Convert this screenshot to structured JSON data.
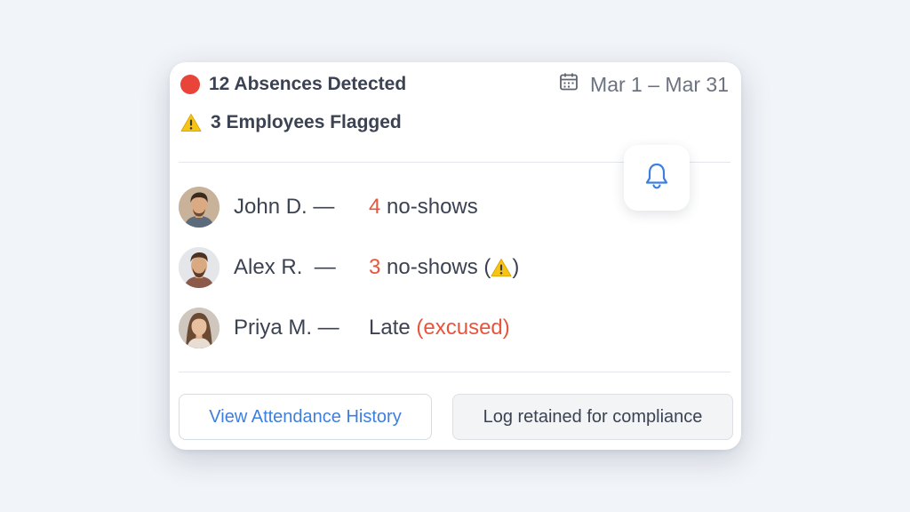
{
  "summary": {
    "absences": "12 Absences Detected",
    "date_range": "Mar 1 – Mar 31",
    "flagged": "3 Employees Flagged"
  },
  "employees": [
    {
      "name": "John D. —",
      "count": "4",
      "status": " no-shows",
      "suffix_pre": "",
      "suffix_post": ""
    },
    {
      "name": "Alex R.  —",
      "count": "3",
      "status": " no-shows (",
      "suffix_post": ")"
    },
    {
      "name": "Priya M. —",
      "status": "Late ",
      "excused": "(excused)"
    }
  ],
  "actions": {
    "history_label": "View Attendance History",
    "log_label": "Log retained for compliance"
  },
  "icons": {
    "status_dot": "red-circle-icon",
    "calendar": "calendar-icon",
    "warning": "warning-icon",
    "bell": "bell-icon"
  },
  "colors": {
    "alert_red": "#e8443a",
    "count_red": "#e8553f",
    "link_blue": "#3d7fe0",
    "warning_yellow": "#f6c417"
  }
}
